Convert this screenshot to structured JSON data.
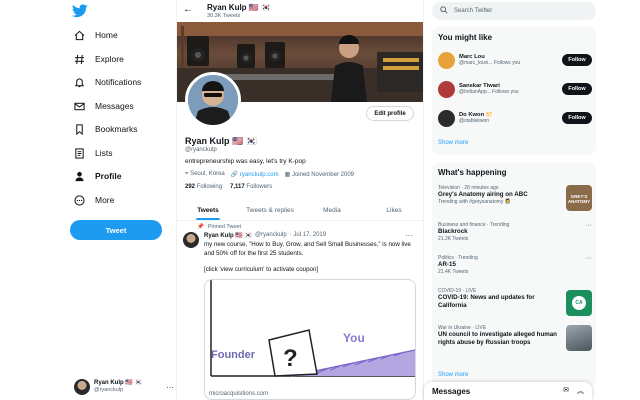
{
  "nav": {
    "items": [
      {
        "label": "Home",
        "icon": "home-icon"
      },
      {
        "label": "Explore",
        "icon": "hashtag-icon"
      },
      {
        "label": "Notifications",
        "icon": "bell-icon"
      },
      {
        "label": "Messages",
        "icon": "envelope-icon"
      },
      {
        "label": "Bookmarks",
        "icon": "bookmark-icon"
      },
      {
        "label": "Lists",
        "icon": "list-icon"
      },
      {
        "label": "Profile",
        "icon": "person-icon"
      },
      {
        "label": "More",
        "icon": "more-circle-icon"
      }
    ],
    "tweet_button": "Tweet",
    "account": {
      "name": "Ryan Kulp 🇺🇸 🇰🇷",
      "handle": "@ryanckulp",
      "more": "···"
    }
  },
  "header": {
    "name": "Ryan Kulp 🇺🇸 🇰🇷",
    "tweet_count": "30.3K Tweets"
  },
  "profile": {
    "edit_label": "Edit profile",
    "name": "Ryan Kulp 🇺🇸 🇰🇷",
    "handle": "@ryanckulp",
    "bio": "entrepreneurship was easy, let's try K-pop",
    "location": "Seoul, Korea",
    "website": "ryanckulp.com",
    "joined": "Joined November 2009",
    "following_count": "292",
    "following_label": "Following",
    "followers_count": "7,117",
    "followers_label": "Followers"
  },
  "tabs": [
    "Tweets",
    "Tweets & replies",
    "Media",
    "Likes"
  ],
  "pinned_tweet": {
    "pinned_label": "Pinned Tweet",
    "name": "Ryan Kulp 🇺🇸 🇰🇷",
    "handle": "@ryanckulp",
    "date": "· Jul 17, 2019",
    "text": "my new course, \"How to Buy, Grow, and Sell Small Businesses,\" is now live and 50% off for the first 25 students.",
    "text2": "[click 'view curriculum' to activate coupon]",
    "card_label_founder": "Founder",
    "card_label_you": "You",
    "card_mark": "?",
    "card_domain": "microacquisitions.com"
  },
  "search": {
    "placeholder": "Search Twitter"
  },
  "you_might_like": {
    "title": "You might like",
    "follow_label": "Follow",
    "show_more": "Show more",
    "people": [
      {
        "name": "Marc Lou",
        "handle": "@marc_louvi...",
        "follows_you": "Follows you",
        "avatar_color": "#e8a23a"
      },
      {
        "name": "Sanskar Tiwari",
        "handle": "@IndianApp...",
        "follows_you": "Follows you",
        "avatar_color": "#b03a3a"
      },
      {
        "name": "Do Kwon 🌕",
        "handle": "@stablekwon",
        "follows_you": "",
        "avatar_color": "#2b2b2b"
      }
    ]
  },
  "whats_happening": {
    "title": "What's happening",
    "show_more": "Show more",
    "trends": [
      {
        "meta": "Television · 28 minutes ago",
        "title": "Grey's Anatomy airing on ABC",
        "sub": "Trending with #greysanatomy 👩‍⚕️",
        "img_color": "#8a6b4a",
        "img_text": "GREY'S ANATOMY"
      },
      {
        "meta": "Business and finance · Trending",
        "title": "Blackrock",
        "sub": "21.2K Tweets"
      },
      {
        "meta": "Politics · Trending",
        "title": "AR-15",
        "sub": "21.4K Tweets"
      },
      {
        "meta": "COVID-19 · LIVE",
        "title": "COVID-19: News and updates for California",
        "sub": "",
        "img_color": "#1c8f5f",
        "img_text": "CA"
      },
      {
        "meta": "War in Ukraine · LIVE",
        "title": "UN council to investigate alleged human rights abuse by Russian troops",
        "sub": "",
        "img_color": "#6d7a84"
      }
    ]
  },
  "messages": {
    "title": "Messages"
  }
}
